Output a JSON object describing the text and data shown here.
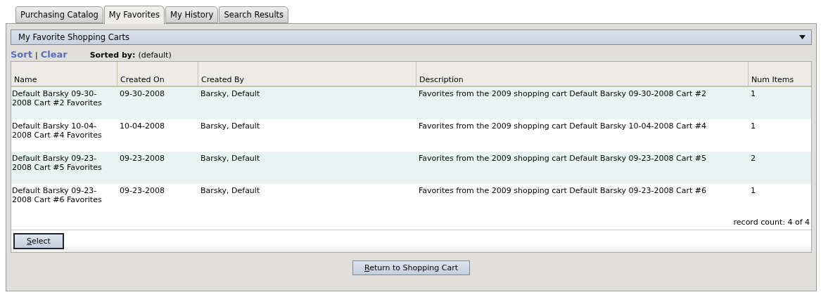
{
  "tabs": [
    {
      "label": "Purchasing Catalog",
      "selected": false
    },
    {
      "label": "My Favorites",
      "selected": true
    },
    {
      "label": "My History",
      "selected": false
    },
    {
      "label": "Search Results",
      "selected": false
    }
  ],
  "dropdown": {
    "value": "My Favorite Shopping Carts"
  },
  "sort_bar": {
    "sort_link": "Sort",
    "separator": "|",
    "clear_link": "Clear",
    "sorted_by_label": "Sorted by:",
    "sorted_by_value": "(default)"
  },
  "table": {
    "columns": [
      "Name",
      "Created On",
      "Created By",
      "Description",
      "Num Items"
    ],
    "rows": [
      {
        "cells": [
          "Default Barsky 09-30-2008 Cart #2 Favorites",
          "09-30-2008",
          "Barsky, Default",
          "Favorites from the 2009 shopping cart Default Barsky 09-30-2008 Cart #2",
          "1"
        ]
      },
      {
        "cells": [
          "Default Barsky 10-04-2008 Cart #4 Favorites",
          "10-04-2008",
          "Barsky, Default",
          "Favorites from the 2009 shopping cart Default Barsky 10-04-2008 Cart #4",
          "1"
        ]
      },
      {
        "cells": [
          "Default Barsky 09-23-2008 Cart #5 Favorites",
          "09-23-2008",
          "Barsky, Default",
          "Favorites from the 2009 shopping cart Default Barsky 09-23-2008 Cart #5",
          "2"
        ]
      },
      {
        "cells": [
          "Default Barsky 09-23-2008 Cart #6 Favorites",
          "09-23-2008",
          "Barsky, Default",
          "Favorites from the 2009 shopping cart Default Barsky 09-23-2008 Cart #6",
          "1"
        ]
      }
    ],
    "record_count": "record count: 4 of 4"
  },
  "select_button": "Select",
  "return_button": "Return to Shopping Cart"
}
